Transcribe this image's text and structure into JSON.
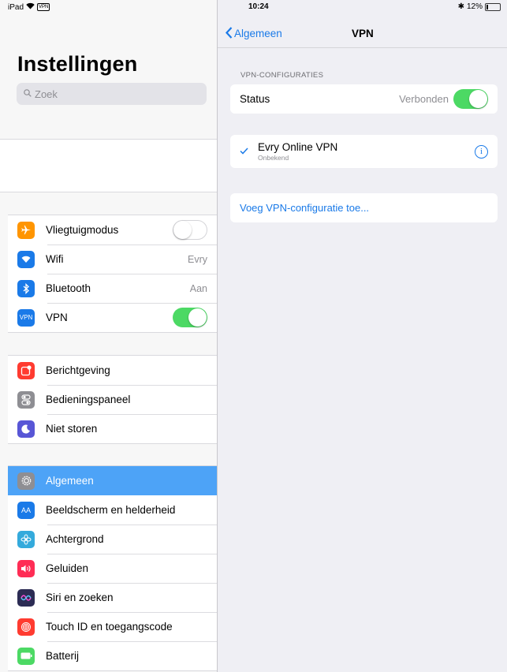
{
  "status_bar": {
    "device": "iPad",
    "vpn_badge": "VPN",
    "time": "10:24",
    "bluetooth": "✱",
    "battery_percent": "12%",
    "battery_level": 0.12
  },
  "master": {
    "title": "Instellingen",
    "search_placeholder": "Zoek",
    "connectivity": [
      {
        "label": "Vliegtuigmodus",
        "icon": "airplane-icon",
        "color": "#ff9500"
      },
      {
        "label": "Wifi",
        "value": "Evry",
        "icon": "wifi-icon",
        "color": "#1a7ae8"
      },
      {
        "label": "Bluetooth",
        "value": "Aan",
        "icon": "bluetooth-icon",
        "color": "#1a7ae8"
      },
      {
        "label": "VPN",
        "icon": "vpn-icon",
        "icon_text": "VPN",
        "color": "#1a7ae8"
      }
    ],
    "notifications": [
      {
        "label": "Berichtgeving",
        "icon": "notifications-icon",
        "color": "#ff3b30"
      },
      {
        "label": "Bedieningspaneel",
        "icon": "control-center-icon",
        "color": "#8e8e93"
      },
      {
        "label": "Niet storen",
        "icon": "moon-icon",
        "color": "#5856d6"
      }
    ],
    "general": [
      {
        "label": "Algemeen",
        "icon": "gear-icon",
        "color": "#8e8e93",
        "selected": true
      },
      {
        "label": "Beeldscherm en helderheid",
        "icon": "display-icon",
        "icon_text": "AA",
        "color": "#1a7ae8"
      },
      {
        "label": "Achtergrond",
        "icon": "wallpaper-icon",
        "color": "#34aadc"
      },
      {
        "label": "Geluiden",
        "icon": "sounds-icon",
        "color": "#ff2d55"
      },
      {
        "label": "Siri en zoeken",
        "icon": "siri-icon",
        "color": "#2c2c54"
      },
      {
        "label": "Touch ID en toegangscode",
        "icon": "fingerprint-icon",
        "color": "#ff3b30"
      },
      {
        "label": "Batterij",
        "icon": "battery-icon",
        "color": "#4cd964"
      }
    ]
  },
  "detail": {
    "back_label": "Algemeen",
    "title": "VPN",
    "section_header": "VPN-CONFIGURATIES",
    "status_label": "Status",
    "status_value": "Verbonden",
    "vpn_name": "Evry Online VPN",
    "vpn_sub": "Onbekend",
    "add_config": "Voeg VPN-configuratie toe..."
  }
}
